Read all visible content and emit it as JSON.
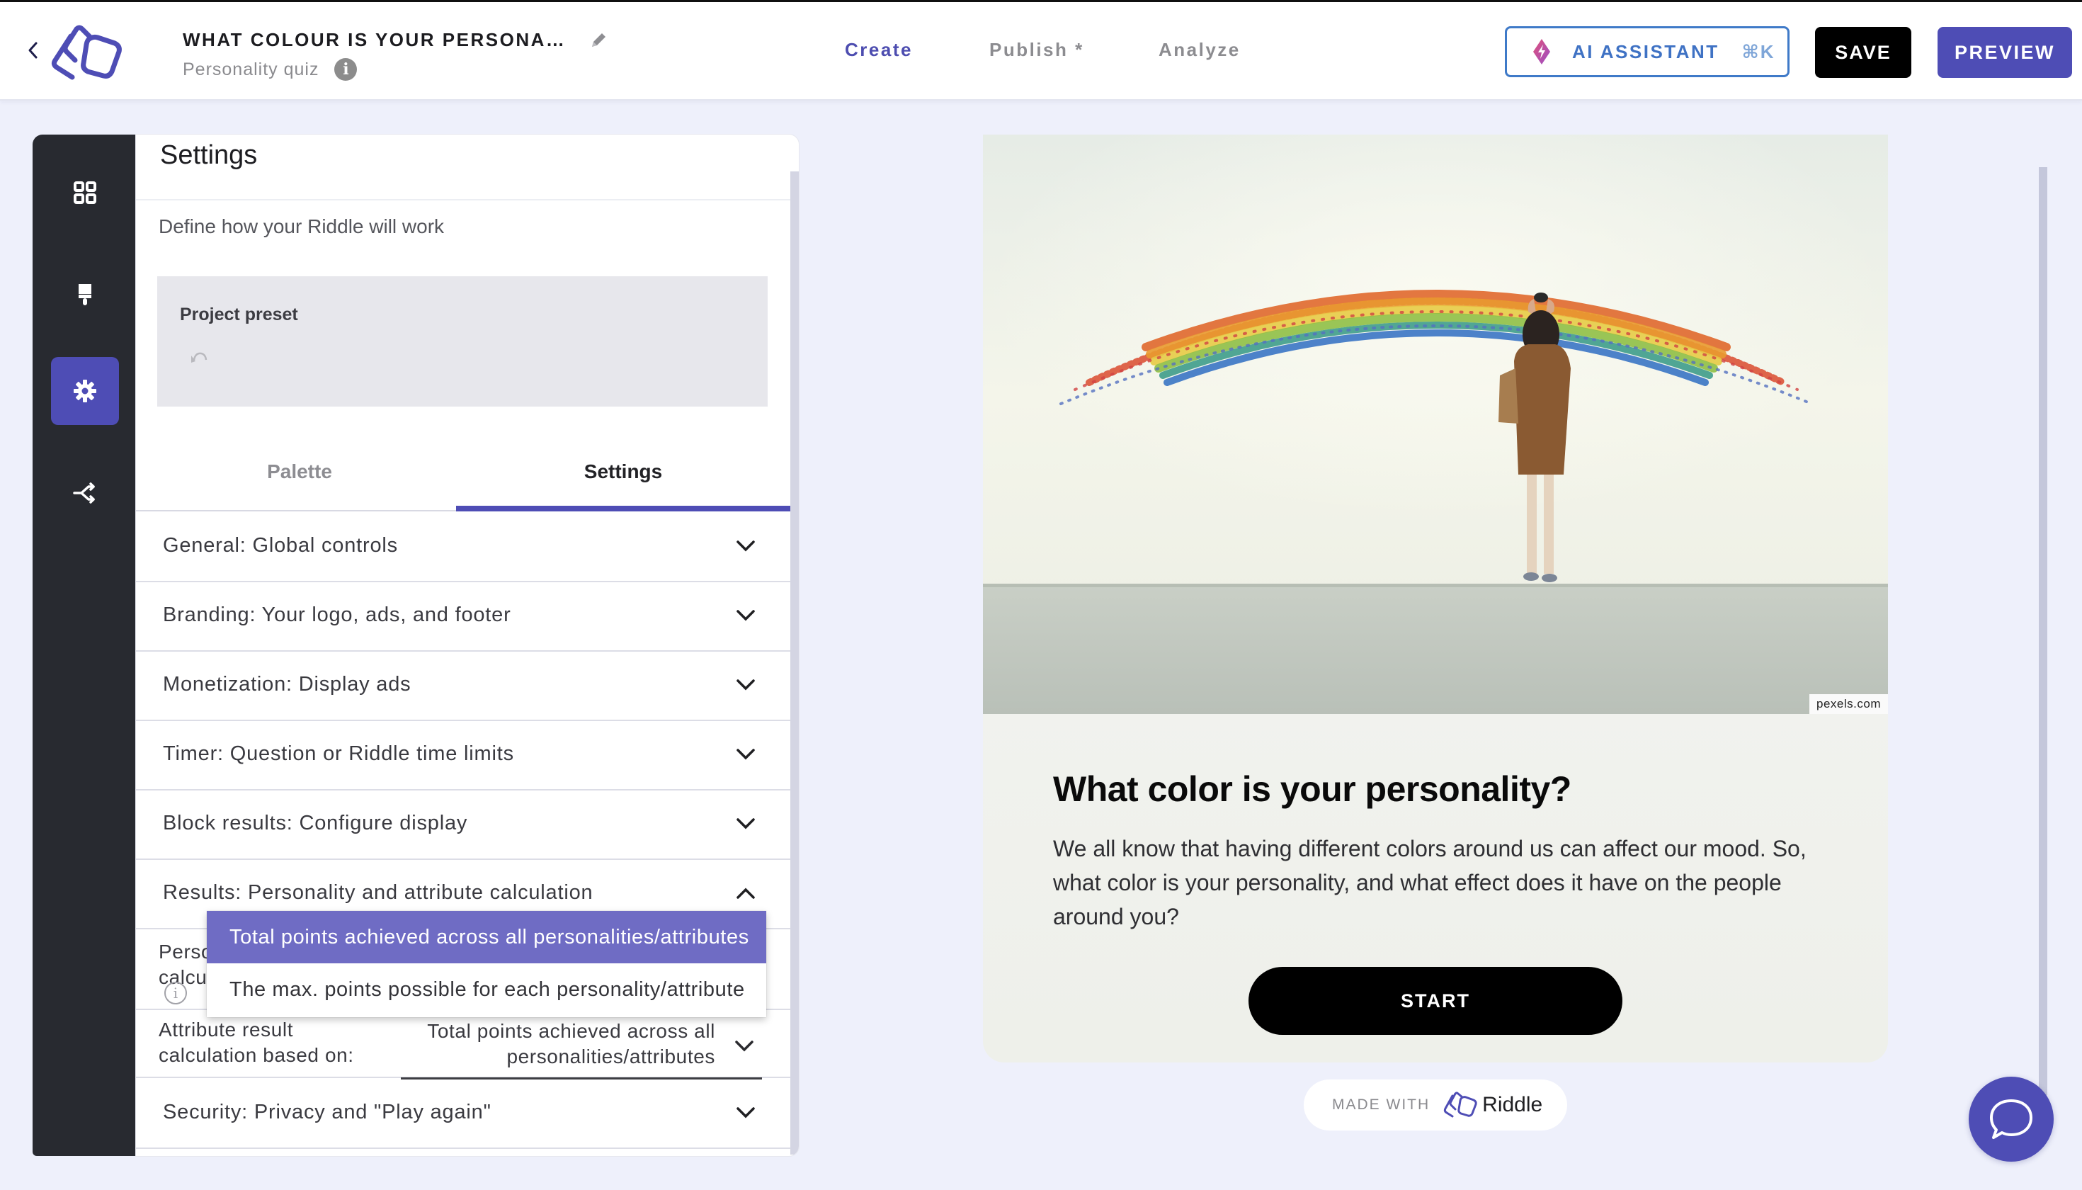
{
  "header": {
    "title": "WHAT COLOUR IS YOUR PERSONA…",
    "subtitle": "Personality quiz",
    "info_glyph": "i",
    "nav": [
      {
        "label": "Create",
        "active": true
      },
      {
        "label": "Publish *",
        "active": false
      },
      {
        "label": "Analyze",
        "active": false
      }
    ],
    "ai_assistant": {
      "label": "AI ASSISTANT",
      "shortcut": "⌘K",
      "icon": "sparkle-bolt-icon"
    },
    "save_label": "SAVE",
    "preview_label": "PREVIEW",
    "colors": {
      "accent": "#4e4db5",
      "ai_blue": "#3f72c4"
    }
  },
  "rail": {
    "items": [
      {
        "name": "blocks",
        "icon": "grid-icon",
        "active": false
      },
      {
        "name": "design",
        "icon": "paint-brush-icon",
        "active": false
      },
      {
        "name": "settings",
        "icon": "gear-icon",
        "active": true
      },
      {
        "name": "logic",
        "icon": "branch-icon",
        "active": false
      }
    ]
  },
  "settings_panel": {
    "title": "Settings",
    "description": "Define how your Riddle will work",
    "preset": {
      "label": "Project preset"
    },
    "tabs": [
      {
        "label": "Palette",
        "active": false
      },
      {
        "label": "Settings",
        "active": true
      }
    ],
    "sections": [
      {
        "label": "General: Global controls",
        "expanded": false
      },
      {
        "label": "Branding: Your logo, ads, and footer",
        "expanded": false
      },
      {
        "label": "Monetization: Display ads",
        "expanded": false
      },
      {
        "label": "Timer: Question or Riddle time limits",
        "expanded": false
      },
      {
        "label": "Block results: Configure display",
        "expanded": false
      },
      {
        "label": "Results: Personality and attribute calculation",
        "expanded": true
      },
      {
        "label": "Security: Privacy and \"Play again\"",
        "expanded": false
      }
    ],
    "results_fields": {
      "personality_label_line1": "Perso",
      "personality_label_line2": "calcu",
      "attribute_label_line1": "Attribute result",
      "attribute_label_line2": "calculation based on:",
      "attribute_value": "Total points achieved across all personalities/attributes"
    },
    "dropdown": {
      "options": [
        {
          "label": "Total points achieved across all personalities/attributes",
          "selected": true
        },
        {
          "label": "The max. points possible for each personality/attribute",
          "selected": false
        }
      ]
    }
  },
  "preview": {
    "image_credit": "pexels.com",
    "quiz_title": "What color is your personality?",
    "quiz_description": "We all know that having different colors around us can affect our mood. So, what color is your personality, and what effect does it have on the people around you?",
    "start_label": "START",
    "made_with": "MADE WITH",
    "brand": "Riddle"
  }
}
